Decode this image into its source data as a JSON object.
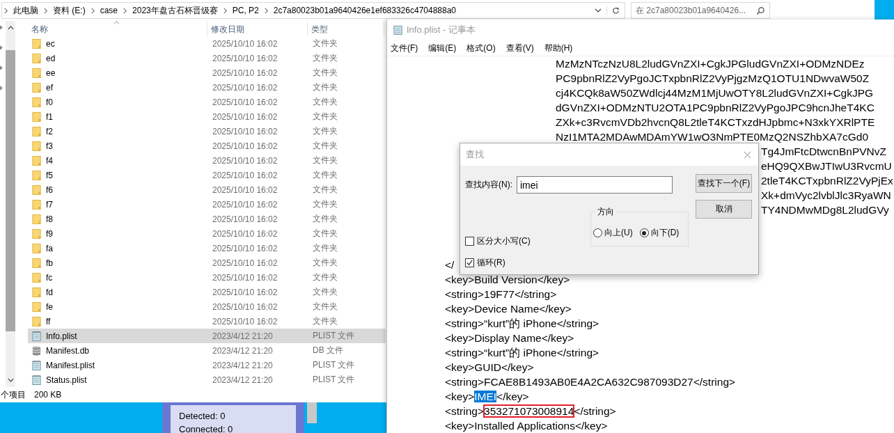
{
  "explorer": {
    "breadcrumbs": [
      "此电脑",
      "资料 (E:)",
      "case",
      "2023年盘古石杯晋级赛",
      "PC, P2",
      "2c7a80023b01a9640426e1ef683326c4704888a0"
    ],
    "search": {
      "placeholder": "在 2c7a80023b01a9640426..."
    },
    "columns": [
      "名称",
      "修改日期",
      "类型"
    ],
    "rows": [
      {
        "kind": "folder",
        "name": "ec",
        "date": "2025/10/10 16:02",
        "type": "文件夹",
        "selected": false
      },
      {
        "kind": "folder",
        "name": "ed",
        "date": "2025/10/10 16:02",
        "type": "文件夹",
        "selected": false
      },
      {
        "kind": "folder",
        "name": "ee",
        "date": "2025/10/10 16:02",
        "type": "文件夹",
        "selected": false
      },
      {
        "kind": "folder",
        "name": "ef",
        "date": "2025/10/10 16:02",
        "type": "文件夹",
        "selected": false
      },
      {
        "kind": "folder",
        "name": "f0",
        "date": "2025/10/10 16:02",
        "type": "文件夹",
        "selected": false
      },
      {
        "kind": "folder",
        "name": "f1",
        "date": "2025/10/10 16:02",
        "type": "文件夹",
        "selected": false
      },
      {
        "kind": "folder",
        "name": "f2",
        "date": "2025/10/10 16:02",
        "type": "文件夹",
        "selected": false
      },
      {
        "kind": "folder",
        "name": "f3",
        "date": "2025/10/10 16:02",
        "type": "文件夹",
        "selected": false
      },
      {
        "kind": "folder",
        "name": "f4",
        "date": "2025/10/10 16:02",
        "type": "文件夹",
        "selected": false
      },
      {
        "kind": "folder",
        "name": "f5",
        "date": "2025/10/10 16:02",
        "type": "文件夹",
        "selected": false
      },
      {
        "kind": "folder",
        "name": "f6",
        "date": "2025/10/10 16:02",
        "type": "文件夹",
        "selected": false
      },
      {
        "kind": "folder",
        "name": "f7",
        "date": "2025/10/10 16:02",
        "type": "文件夹",
        "selected": false
      },
      {
        "kind": "folder",
        "name": "f8",
        "date": "2025/10/10 16:02",
        "type": "文件夹",
        "selected": false
      },
      {
        "kind": "folder",
        "name": "f9",
        "date": "2025/10/10 16:02",
        "type": "文件夹",
        "selected": false
      },
      {
        "kind": "folder",
        "name": "fa",
        "date": "2025/10/10 16:02",
        "type": "文件夹",
        "selected": false
      },
      {
        "kind": "folder",
        "name": "fb",
        "date": "2025/10/10 16:02",
        "type": "文件夹",
        "selected": false
      },
      {
        "kind": "folder",
        "name": "fc",
        "date": "2025/10/10 16:02",
        "type": "文件夹",
        "selected": false
      },
      {
        "kind": "folder",
        "name": "fd",
        "date": "2025/10/10 16:02",
        "type": "文件夹",
        "selected": false
      },
      {
        "kind": "folder",
        "name": "fe",
        "date": "2025/10/10 16:02",
        "type": "文件夹",
        "selected": false
      },
      {
        "kind": "folder",
        "name": "ff",
        "date": "2025/10/10 16:02",
        "type": "文件夹",
        "selected": false
      },
      {
        "kind": "text",
        "name": "Info.plist",
        "date": "2023/4/12 21:20",
        "type": "PLIST 文件",
        "selected": true
      },
      {
        "kind": "database",
        "name": "Manifest.db",
        "date": "2023/4/12 21:20",
        "type": "DB 文件",
        "selected": false
      },
      {
        "kind": "text",
        "name": "Manifest.plist",
        "date": "2023/4/12 21:20",
        "type": "PLIST 文件",
        "selected": false
      },
      {
        "kind": "text",
        "name": "Status.plist",
        "date": "2023/4/12 21:20",
        "type": "PLIST 文件",
        "selected": false
      }
    ],
    "status": {
      "count": "个项目",
      "size": "200 KB"
    }
  },
  "notepad": {
    "title": "Info.plist - 记事本",
    "menu": [
      "文件(F)",
      "编辑(E)",
      "格式(O)",
      "查看(V)",
      "帮助(H)"
    ],
    "lines_top": [
      {
        "kind": "full",
        "text": "MzMzNTczNzU8L2ludGVnZXI+CgkJPGludGVnZXI+ODMzNDEz"
      },
      {
        "kind": "full",
        "text": "PC9pbnRlZ2VyPgoJCTxpbnRlZ2VyPjgzMzQ1OTU1NDwvaW50Z"
      },
      {
        "kind": "full",
        "text": "cj4KCQk8aW50ZWdlcj44MzM1MjUwOTY8L2ludGVnZXI+CgkJPG"
      },
      {
        "kind": "full",
        "text": "dGVnZXI+ODMzNTU2OTA1PC9pbnRlZ2VyPgoJPC9hcnJheT4KC"
      },
      {
        "kind": "full",
        "text": "ZXk+c3RvcmVDb2hvcnQ8L2tleT4KCTxzdHJpbmc+N3xkYXRlPTE"
      },
      {
        "kind": "full",
        "text": "NzI1MTA2MDAwMDAmYW1wO3NmPTE0MzQ2NSZhbXA7cGd0"
      },
      {
        "kind": "tail",
        "text": "Tg4JmFtcDtwcnBnPVNvZ"
      },
      {
        "kind": "tail",
        "text": "eHQ9QXBwJTIwU3RvcmU"
      },
      {
        "kind": "tail",
        "text": "2tleT4KCTxpbnRlZ2VyPjEx"
      },
      {
        "kind": "tail",
        "text": "Xk+dmVyc2lvblJlc3RyaWN"
      },
      {
        "kind": "tail",
        "text": "TY4NDMwMDg8L2ludGVy"
      }
    ],
    "lines_bottom": [
      {
        "kind": "plain",
        "text": "</"
      },
      {
        "kind": "plain",
        "text": "<key>Build Version</key>"
      },
      {
        "kind": "plain",
        "text": "<string>19F77</string>"
      },
      {
        "kind": "plain",
        "text": "<key>Device Name</key>"
      },
      {
        "kind": "plain",
        "text": "<string>“kurt”的 iPhone</string>"
      },
      {
        "kind": "plain",
        "text": "<key>Display Name</key>"
      },
      {
        "kind": "plain",
        "text": "<string>“kurt”的 iPhone</string>"
      },
      {
        "kind": "plain",
        "text": "<key>GUID</key>"
      },
      {
        "kind": "plain",
        "text": "<string>FCAE8B1493AB0E4A2CA632C987093D27</string>"
      },
      {
        "kind": "selected",
        "before": "<key>",
        "mark": "IMEI",
        "after": "</key>"
      },
      {
        "kind": "boxed",
        "before": "<string>",
        "mark": "353271073008914",
        "after": "</string>"
      },
      {
        "kind": "plain",
        "text": "<key>Installed Applications</key>"
      }
    ]
  },
  "find_dialog": {
    "title": "查找",
    "label": "查找内容(N):",
    "value": "imei",
    "buttons": [
      "查找下一个(F)",
      "取消"
    ],
    "direction": {
      "title": "方向",
      "options": [
        {
          "label": "向上(U)",
          "selected": false
        },
        {
          "label": "向下(D)",
          "selected": true
        }
      ]
    },
    "options": [
      {
        "label": "区分大小写(C)",
        "checked": false
      },
      {
        "label": "循环(R)",
        "checked": true
      }
    ]
  },
  "background_window": {
    "lines": [
      "Detected: 0",
      "Connected: 0"
    ]
  }
}
